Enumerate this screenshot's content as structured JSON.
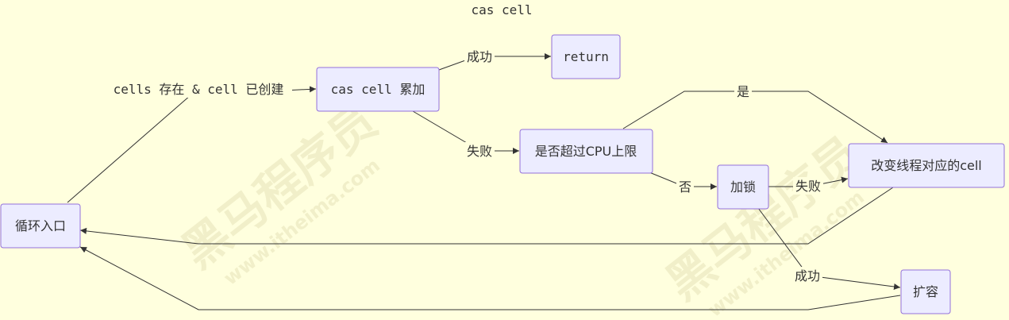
{
  "title": "cas cell",
  "nodes": {
    "loop_entry": "循环入口",
    "cas_add": "cas cell 累加",
    "return": "return",
    "cpu_limit": "是否超过CPU上限",
    "change_thread_cell": "改变线程对应的cell",
    "lock": "加锁",
    "expand": "扩容"
  },
  "edges": {
    "cells_exist": "cells 存在 & cell 已创建",
    "cas_success": "成功",
    "cas_fail": "失败",
    "yes": "是",
    "no": "否",
    "lock_fail": "失败",
    "lock_success": "成功"
  },
  "watermark": {
    "text": "黑马程序员",
    "url": "www.itheima.com"
  }
}
